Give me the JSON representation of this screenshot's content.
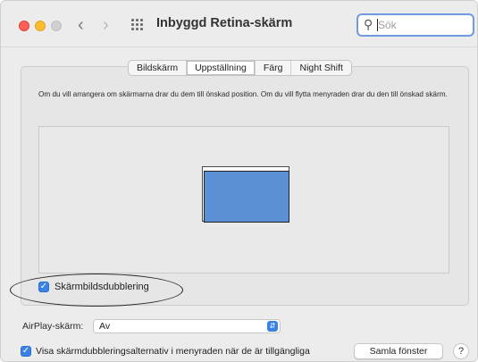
{
  "window": {
    "title": "Inbyggd Retina-skärm",
    "back_glyph": "‹",
    "forward_glyph": "›",
    "grid_icon": "grid-icon"
  },
  "search": {
    "placeholder": "Sök",
    "icon": "search-icon"
  },
  "tabs": [
    {
      "label": "Bildskärm",
      "active": false
    },
    {
      "label": "Uppställning",
      "active": true
    },
    {
      "label": "Färg",
      "active": false
    },
    {
      "label": "Night Shift",
      "active": false
    }
  ],
  "arrangement": {
    "description": "Om du vill arrangera om skärmarna drar du dem till önskad position. Om du vill flytta menyraden drar du den till önskad skärm."
  },
  "mirroring": {
    "label": "Skärmbildsdubblering",
    "checked": true
  },
  "airplay": {
    "label": "AirPlay-skärm:",
    "value": "Av"
  },
  "footer": {
    "show_options_label": "Visa skärmdubbleringsalternativ i menyraden när de är tillgängliga",
    "show_options_checked": true,
    "gather_button": "Samla fönster",
    "help_glyph": "?"
  },
  "colors": {
    "accent": "#3b82e6",
    "display": "#5b90d4"
  }
}
